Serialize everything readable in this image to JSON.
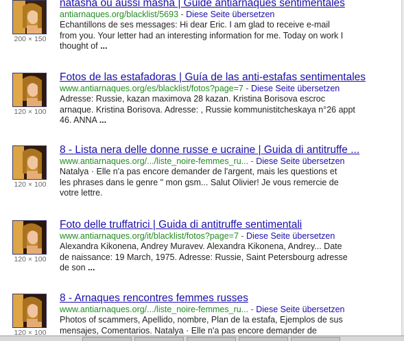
{
  "results": [
    {
      "title": "natasha ou aussi masha | Guide antiarnaques sentimentales",
      "url": "antiarnaques.org/blacklist/5693",
      "separator": " - ",
      "translate": "Diese Seite übersetzen",
      "snippet_lines": [
        "Echantillons de ses messages: Hi dear Eric. I am glad to receive e-mail",
        "from you. Your letter had an interesting information for me. Today on work I",
        "thought of "
      ],
      "ellipsis": "...",
      "thumb_dims": "200 × 150"
    },
    {
      "title": "Fotos de las estafadoras | Guía de las anti-estafas sentimentales",
      "url": "www.antiarnaques.org/es/blacklist/fotos?page=7",
      "separator": " - ",
      "translate": "Diese Seite übersetzen",
      "snippet_lines": [
        "Adresse: Russie, kazan maximova 28 kazan. Kristina Borisova escroc",
        "arnaque. Kristina Borisova. Adresse: , Russie kommunistitcheskaya n°26 appt",
        "46. ANNA "
      ],
      "ellipsis": "...",
      "thumb_dims": "120 × 100"
    },
    {
      "title": "8 - Lista nera delle donne russe e ucraine | Guida di antitruffe ...",
      "url": "www.antiarnaques.org/.../liste_noire-femmes_ru...",
      "separator": " - ",
      "translate": "Diese Seite übersetzen",
      "snippet_lines": [
        "Natalya · Elle n'a pas encore demander de l'argent, mais les questions et",
        "les phrases dans le genre \" mon gsm... Salut Olivier! Je vous remercie de",
        "votre lettre."
      ],
      "ellipsis": "",
      "thumb_dims": "120 × 100"
    },
    {
      "title": "Foto delle truffatrici | Guida di antitruffe sentimentali",
      "url": "www.antiarnaques.org/it/blacklist/fotos?page=7",
      "separator": " - ",
      "translate": "Diese Seite übersetzen",
      "snippet_lines": [
        "Alexandra Kikonena, Andrey Muravev. Alexandra Kikonena, Andrey... Date",
        "de naissance: 19 March, 1975. Adresse: Russie, Saint Petersbourg adresse",
        "de son "
      ],
      "ellipsis": "...",
      "thumb_dims": "120 × 100"
    },
    {
      "title": "8 - Arnaques rencontres femmes russes",
      "url": "www.antiarnaques.org/.../liste_noire-femmes_ru...",
      "separator": " - ",
      "translate": "Diese Seite übersetzen",
      "snippet_lines": [
        "Photos of scammers, Apellido, nombre, Plan de la estafa, Ejemplos de sus",
        "mensajes, Comentarios. Natalya · Elle n'a pas encore demander de"
      ],
      "ellipsis": "",
      "thumb_dims": "120 × 100"
    }
  ],
  "colors": {
    "title": "#1a0dab",
    "url": "#228b22",
    "snippet": "#222222",
    "dims": "#666666"
  }
}
